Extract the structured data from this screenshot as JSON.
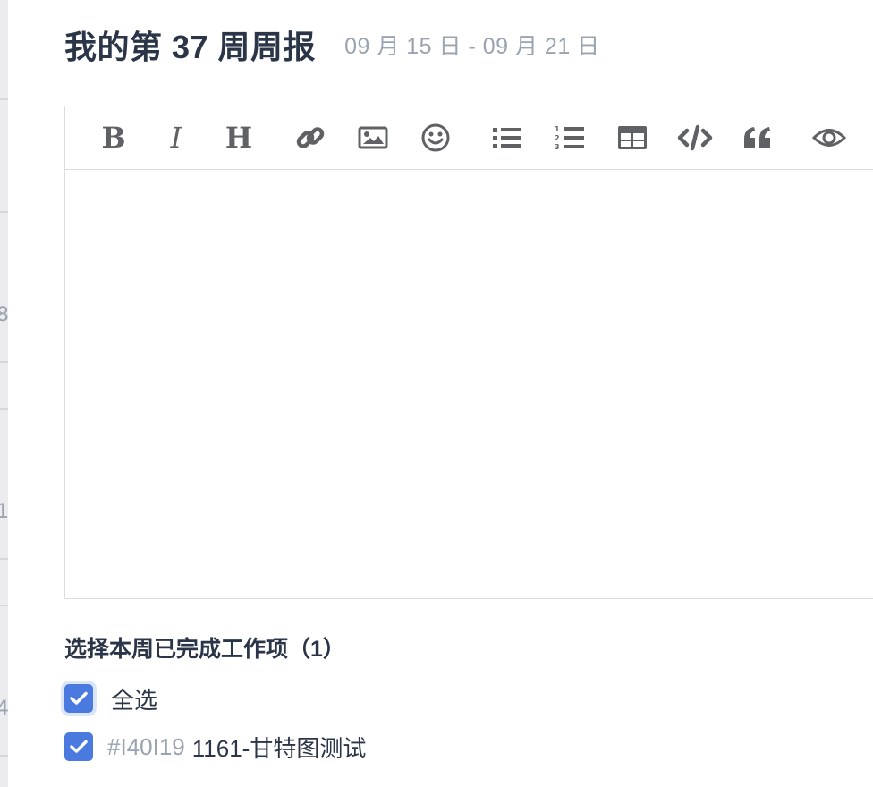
{
  "header": {
    "title": "我的第 37 周周报",
    "date_range": "09 月 15 日 - 09 月 21 日"
  },
  "background_fragments": [
    "8",
    "1",
    "4"
  ],
  "editor": {
    "toolbar": [
      {
        "name": "bold",
        "label": "B"
      },
      {
        "name": "italic",
        "label": "I"
      },
      {
        "name": "heading",
        "label": "H"
      },
      {
        "name": "link",
        "icon": "link-icon"
      },
      {
        "name": "image",
        "icon": "image-icon"
      },
      {
        "name": "emoji",
        "icon": "emoji-icon"
      },
      {
        "name": "bullet-list",
        "icon": "bullet-list-icon"
      },
      {
        "name": "numbered-list",
        "icon": "numbered-list-icon"
      },
      {
        "name": "table",
        "icon": "table-icon"
      },
      {
        "name": "code",
        "icon": "code-icon"
      },
      {
        "name": "quote",
        "icon": "quote-icon"
      },
      {
        "name": "preview",
        "icon": "eye-icon"
      }
    ],
    "content": ""
  },
  "completed_section": {
    "heading": "选择本周已完成工作项（1）",
    "select_all": {
      "label": "全选",
      "checked": true
    },
    "items": [
      {
        "id": "#I40I19",
        "title": "1161-甘特图测试",
        "checked": true
      }
    ]
  },
  "colors": {
    "accent": "#4a7ae0",
    "title": "#2b3548",
    "muted": "#9aa3b1",
    "border": "#d9dce1",
    "icon": "#5f6165"
  }
}
